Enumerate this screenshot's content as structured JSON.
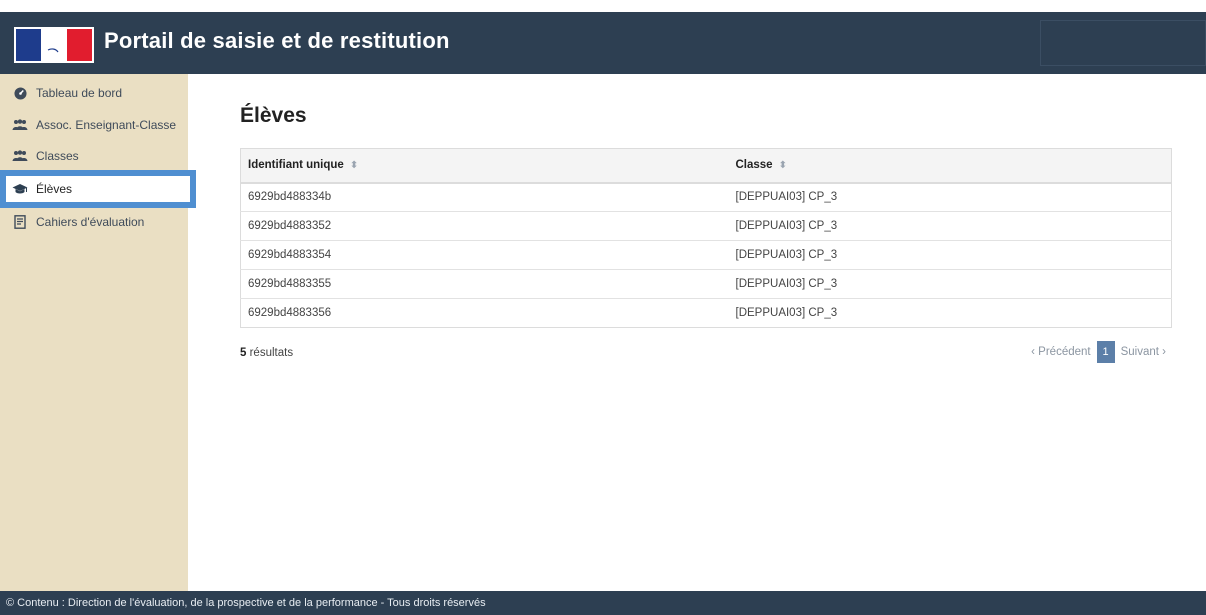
{
  "header": {
    "title": "Portail de saisie et de restitution"
  },
  "sidebar": {
    "items": [
      {
        "label": "Tableau de bord",
        "icon": "dashboard-icon"
      },
      {
        "label": "Assoc. Enseignant-Classe",
        "icon": "users-icon"
      },
      {
        "label": "Classes",
        "icon": "users-icon"
      },
      {
        "label": "Élèves",
        "icon": "graduation-cap-icon",
        "active": true
      },
      {
        "label": "Cahiers d'évaluation",
        "icon": "document-icon"
      }
    ]
  },
  "main": {
    "title": "Élèves",
    "table": {
      "headers": [
        "Identifiant unique",
        "Classe"
      ],
      "rows": [
        [
          "6929bd488334b",
          "[DEPPUAI03] CP_3"
        ],
        [
          "6929bd4883352",
          "[DEPPUAI03] CP_3"
        ],
        [
          "6929bd4883354",
          "[DEPPUAI03] CP_3"
        ],
        [
          "6929bd4883355",
          "[DEPPUAI03] CP_3"
        ],
        [
          "6929bd4883356",
          "[DEPPUAI03] CP_3"
        ]
      ]
    },
    "results_count": "5",
    "results_label": " résultats",
    "pagination": {
      "prev": "‹ Précédent",
      "current": "1",
      "next": "Suivant ›"
    }
  },
  "footer": {
    "text": "© Contenu : Direction de l'évaluation, de la prospective et de la performance - Tous droits réservés"
  },
  "colors": {
    "header": "#2d3f52",
    "sidebar": "#eadfc3",
    "active_outline": "#4f8fd1",
    "pager_current": "#5c7fa8"
  }
}
